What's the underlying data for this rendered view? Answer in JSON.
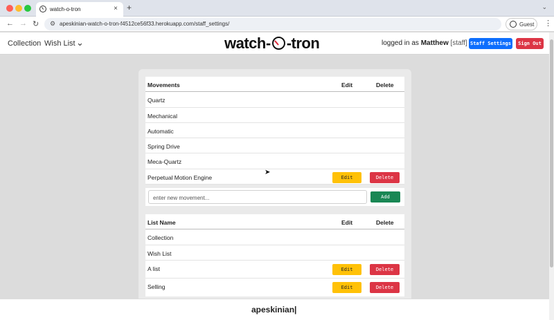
{
  "browser": {
    "tab_title": "watch-o-tron",
    "tab_close": "×",
    "new_tab": "+",
    "tab_menu": "⌄",
    "back": "←",
    "forward": "→",
    "reload": "↻",
    "url": "apeskinian-watch-o-tron-f4512ce56f33.herokuapp.com/staff_settings/",
    "profile_label": "Guest",
    "menu": "⋮"
  },
  "header": {
    "nav": [
      "Collection",
      "Wish List"
    ],
    "dropdown_icon": "⌄",
    "logo_left": "watch-",
    "logo_right": "-tron",
    "logged_in_prefix": "logged in as",
    "username": "Matthew",
    "role": "[staff]",
    "staff_settings_label": "Staff Settings",
    "sign_out_label": "Sign Out"
  },
  "movements": {
    "headers": [
      "Movements",
      "Edit",
      "Delete"
    ],
    "rows": [
      "Quartz",
      "Mechanical",
      "Automatic",
      "Spring Drive",
      "Meca-Quartz",
      "Perpetual Motion Engine"
    ],
    "edit_label": "Edit",
    "delete_label": "Delete",
    "input_placeholder": "enter new movement...",
    "add_label": "Add"
  },
  "lists": {
    "headers": [
      "List Name",
      "Edit",
      "Delete"
    ],
    "rows": [
      "Collection",
      "Wish List",
      "A list",
      "Selling"
    ],
    "edit_label": "Edit",
    "delete_label": "Delete"
  },
  "footer": {
    "typed_text": "apeskinian|"
  }
}
